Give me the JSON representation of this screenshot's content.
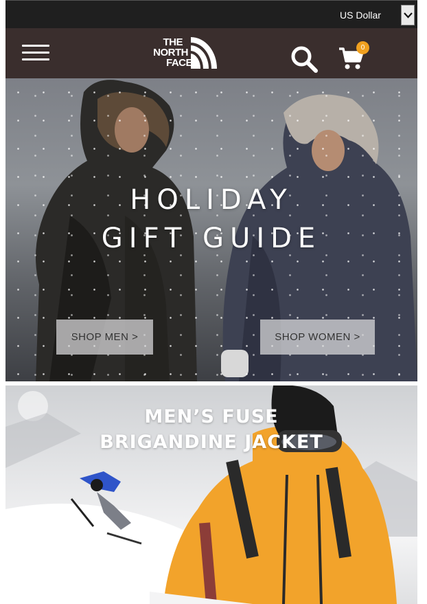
{
  "currency": {
    "selected": "US Dollar"
  },
  "header": {
    "logo_lines": [
      "THE",
      "NORTH",
      "FACE"
    ],
    "cart_count": "0"
  },
  "hero_holiday": {
    "title_line1": "HOLIDAY",
    "title_line2": "GIFT GUIDE",
    "shop_men_label": "SHOP MEN >",
    "shop_women_label": "SHOP WOMEN >"
  },
  "hero_product": {
    "title_line1": "MEN’S FUSE",
    "title_line2": "BRIGANDINE JACKET"
  },
  "colors": {
    "currency_bar": "#1f1f1f",
    "header_bg": "#3a2e2d",
    "cart_badge": "#f0a01f",
    "jacket_orange": "#f2a32b"
  },
  "icons": [
    "hamburger-menu-icon",
    "search-icon",
    "cart-icon",
    "chevron-down-icon",
    "half-dome-logo-icon"
  ]
}
